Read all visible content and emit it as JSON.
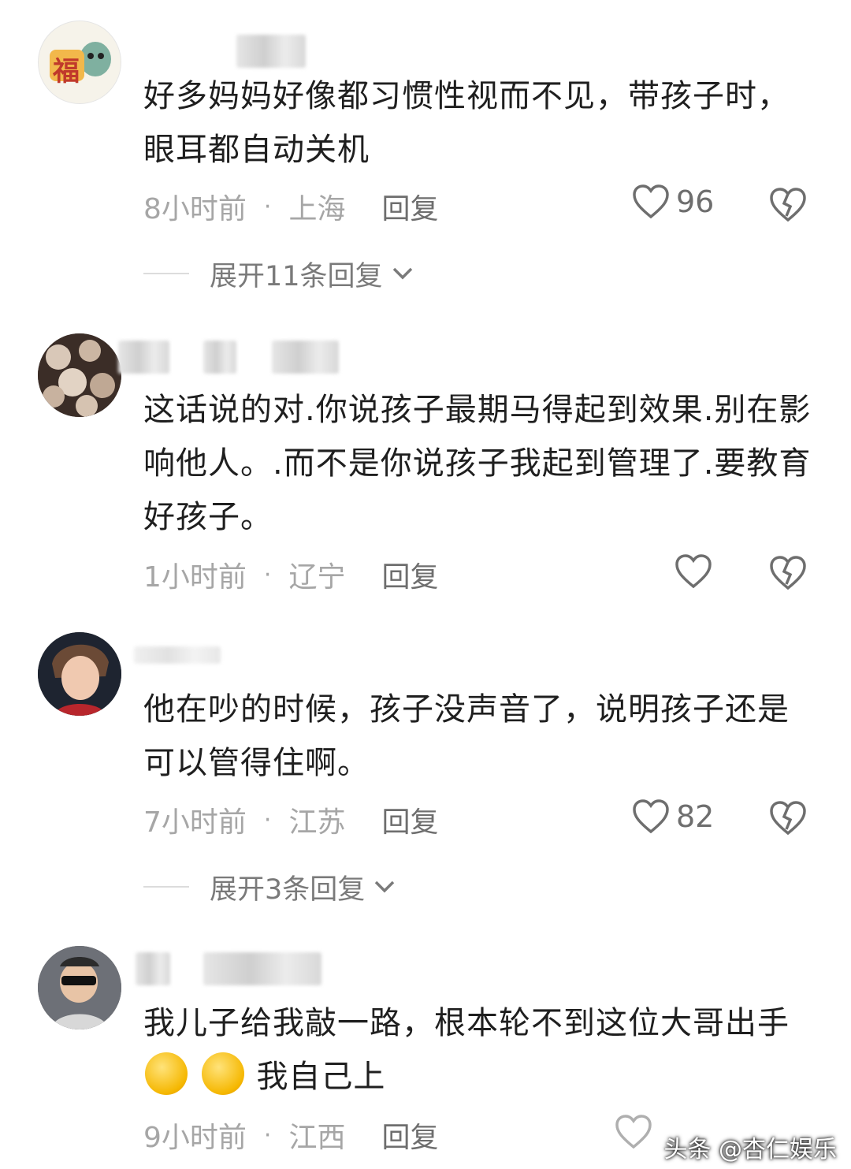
{
  "comments": [
    {
      "avatar_label": "福",
      "text": "好多妈妈好像都习惯性视而不见，带孩子时，眼耳都自动关机",
      "time": "8小时前",
      "location": "上海",
      "reply_label": "回复",
      "likes": "96",
      "expand_label": "展开11条回复"
    },
    {
      "text": "这话说的对.你说孩子最期马得起到效果.别在影响他人。.而不是你说孩子我起到管理了.要教育好孩子。",
      "time": "1小时前",
      "location": "辽宁",
      "reply_label": "回复",
      "likes": ""
    },
    {
      "text": "他在吵的时候，孩子没声音了，说明孩子还是可以管得住啊。",
      "time": "7小时前",
      "location": "江苏",
      "reply_label": "回复",
      "likes": "82",
      "expand_label": "展开3条回复"
    },
    {
      "text_part1": "我儿子给我敲一路，根本轮不到这位大哥出手",
      "text_part2": "我自己上",
      "time": "9小时前",
      "location": "江西",
      "reply_label": "回复"
    }
  ],
  "watermark": "头条 @杏仁娱乐",
  "colors": {
    "meta_gray": "#a6a6a6",
    "action_gray": "#6e6e6e",
    "text": "#1f1f1f"
  }
}
